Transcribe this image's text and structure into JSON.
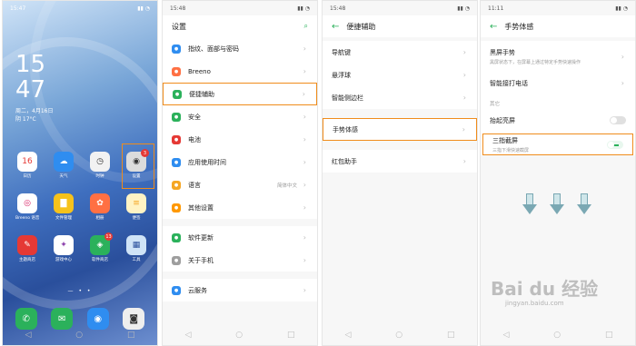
{
  "home": {
    "status_time": "15:47",
    "clock": [
      "15",
      "47"
    ],
    "date_line": "周二，4月16日",
    "weather": "阴 17°C",
    "apps": [
      {
        "label": "日历",
        "color": "#ffffff",
        "text": "16",
        "text_color": "#e53935"
      },
      {
        "label": "天气",
        "color": "#2f8df0",
        "text": "☁",
        "text_color": "#ffffff"
      },
      {
        "label": "时钟",
        "color": "#f2f2f2",
        "text": "◷",
        "text_color": "#333333"
      },
      {
        "label": "设置",
        "color": "#dcdcdc",
        "text": "◉",
        "text_color": "#333333",
        "badge": "3"
      },
      {
        "label": "Breeno 语音",
        "color": "#ffffff",
        "text": "◎",
        "text_color": "#d81b60"
      },
      {
        "label": "文件管理",
        "color": "#f6c21b",
        "text": "▇",
        "text_color": "#ffffff"
      },
      {
        "label": "相册",
        "color": "#ff7043",
        "text": "✿",
        "text_color": "#ffffff"
      },
      {
        "label": "便签",
        "color": "#fff3c4",
        "text": "≡",
        "text_color": "#f5a623"
      },
      {
        "label": "主题商店",
        "color": "#e53935",
        "text": "✎",
        "text_color": "#ffffff"
      },
      {
        "label": "游戏中心",
        "color": "#ffffff",
        "text": "✦",
        "text_color": "#8e44ad"
      },
      {
        "label": "软件商店",
        "color": "#2bb15b",
        "text": "◈",
        "text_color": "#ffffff",
        "badge": "13"
      },
      {
        "label": "工具",
        "color": "#cfe3f7",
        "text": "▦",
        "text_color": "#2a4f9c"
      }
    ],
    "dock": [
      {
        "name": "phone",
        "color": "#2bb15b",
        "text": "✆"
      },
      {
        "name": "messages",
        "color": "#2bb15b",
        "text": "✉"
      },
      {
        "name": "browser",
        "color": "#2f8df0",
        "text": "◉"
      },
      {
        "name": "camera",
        "color": "#eeeeee",
        "text": "◙"
      }
    ]
  },
  "settings": {
    "status_time": "15:48",
    "title": "设置",
    "items": [
      {
        "label": "指纹、面部与密码",
        "color": "#2f8df0",
        "extra": ""
      },
      {
        "label": "Breeno",
        "color": "#ff7043",
        "extra": ""
      },
      {
        "label": "便捷辅助",
        "color": "#2bb15b",
        "extra": ""
      },
      {
        "label": "安全",
        "color": "#2bb15b",
        "extra": ""
      },
      {
        "label": "电池",
        "color": "#e53935",
        "extra": ""
      },
      {
        "label": "应用使用时间",
        "color": "#2f8df0",
        "extra": ""
      },
      {
        "label": "语言",
        "color": "#f5a623",
        "extra": "简体中文"
      },
      {
        "label": "其他设置",
        "color": "#ff9800",
        "extra": ""
      },
      {
        "label": "软件更新",
        "color": "#2bb15b",
        "extra": ""
      },
      {
        "label": "关于手机",
        "color": "#9e9e9e",
        "extra": ""
      },
      {
        "label": "云服务",
        "color": "#2f8df0",
        "extra": ""
      }
    ]
  },
  "assist": {
    "status_time": "15:48",
    "title": "便捷辅助",
    "items": [
      "导航键",
      "悬浮球",
      "智能侧边栏",
      "手势体感",
      "红包助手"
    ]
  },
  "gesture": {
    "status_time": "11:11",
    "title": "手势体感",
    "black_screen": "黑屏手势",
    "black_screen_sub": "黑屏状态下，在屏幕上通过特定手势快速操作",
    "smart_call": "智能接打电话",
    "section_other": "其它",
    "raise_wake": "抬起亮屏",
    "three_finger": "三指截屏",
    "three_finger_sub": "三指下滑快速截屏"
  },
  "watermark": {
    "text": "Bai du 经验",
    "url": "jingyan.baidu.com"
  }
}
